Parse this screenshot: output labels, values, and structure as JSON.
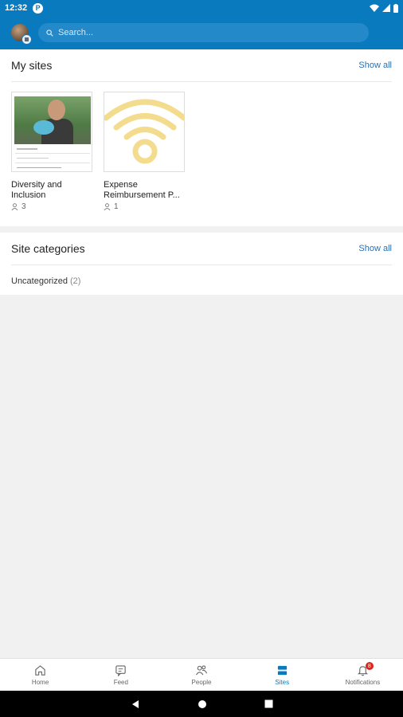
{
  "status_bar": {
    "time": "12:32",
    "app_badge": "P"
  },
  "header": {
    "search_placeholder": "Search..."
  },
  "my_sites": {
    "title": "My sites",
    "show_all": "Show all",
    "sites": [
      {
        "name": "Diversity and Inclusion",
        "members": "3"
      },
      {
        "name": "Expense Reimbursement P...",
        "members": "1"
      }
    ]
  },
  "site_categories": {
    "title": "Site categories",
    "show_all": "Show all",
    "items": [
      {
        "label": "Uncategorized",
        "count": "(2)"
      }
    ]
  },
  "bottom_nav": {
    "items": [
      {
        "label": "Home",
        "icon": "home-icon"
      },
      {
        "label": "Feed",
        "icon": "feed-icon"
      },
      {
        "label": "People",
        "icon": "people-icon"
      },
      {
        "label": "Sites",
        "icon": "sites-icon"
      },
      {
        "label": "Notifications",
        "icon": "bell-icon"
      }
    ],
    "active": "Sites",
    "notification_count": "8"
  },
  "colors": {
    "brand": "#0a7abf",
    "link": "#2a6fb0",
    "badge": "#d9261c"
  }
}
